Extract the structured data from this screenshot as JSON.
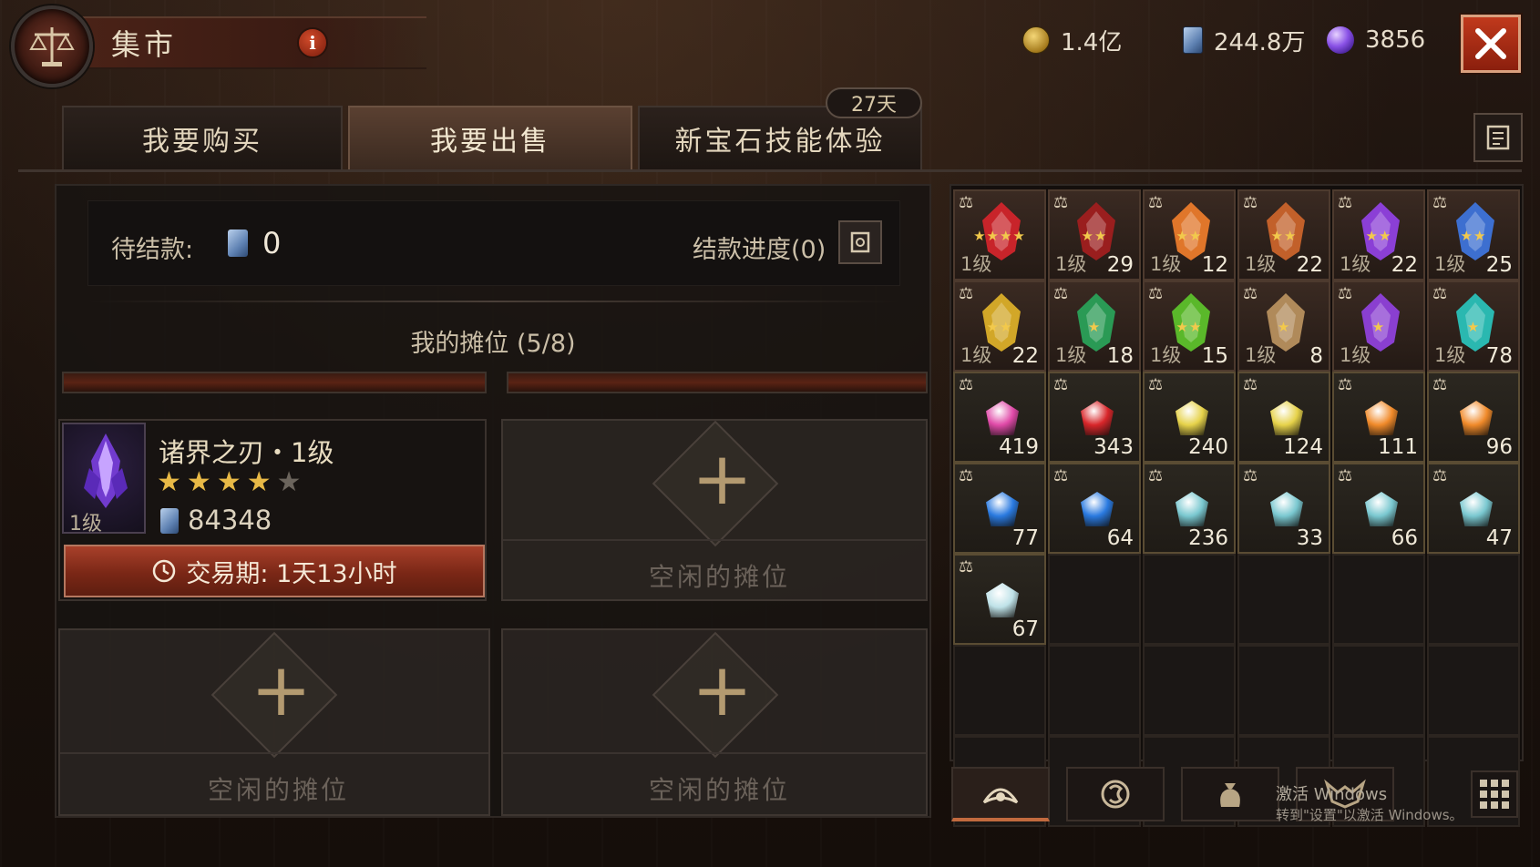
{
  "header": {
    "title": "集市",
    "info_icon_label": "i",
    "currencies": [
      {
        "icon": "gold-coin-icon",
        "value": "1.4亿"
      },
      {
        "icon": "platinum-icon",
        "value": "244.8万"
      },
      {
        "icon": "eternal-orb-icon",
        "value": "3856"
      }
    ],
    "close_icon": "close-icon"
  },
  "tabs": [
    {
      "label": "我要购买",
      "active": false
    },
    {
      "label": "我要出售",
      "active": true
    },
    {
      "label": "新宝石技能体验",
      "active": false
    }
  ],
  "days_badge": "27天",
  "sell": {
    "pending_label": "待结款:",
    "pending_value": "0",
    "settle_label": "结款进度(0)",
    "stalls_title": "我的摊位 (5/8)",
    "listed": {
      "name": "诸界之刃・1级",
      "level": "1级",
      "stars": 4,
      "max_stars": 5,
      "price": "84348",
      "trade_period_label": "交易期: 1天13小时"
    },
    "empty_stall_label": "空闲的摊位",
    "plus_symbol": "+"
  },
  "inventory": {
    "charms": [
      {
        "level": "1级",
        "qty": "",
        "stars": 4,
        "color": "#c8242a"
      },
      {
        "level": "1级",
        "qty": "29",
        "stars": 2,
        "color": "#9a1e1e"
      },
      {
        "level": "1级",
        "qty": "12",
        "stars": 2,
        "color": "#e0762a"
      },
      {
        "level": "1级",
        "qty": "22",
        "stars": 2,
        "color": "#c2602a"
      },
      {
        "level": "1级",
        "qty": "22",
        "stars": 2,
        "color": "#8b3fd6"
      },
      {
        "level": "1级",
        "qty": "25",
        "stars": 2,
        "color": "#3d6fd0"
      },
      {
        "level": "1级",
        "qty": "22",
        "stars": 2,
        "color": "#d2a728"
      },
      {
        "level": "1级",
        "qty": "18",
        "stars": 1,
        "color": "#2a9a55"
      },
      {
        "level": "1级",
        "qty": "15",
        "stars": 2,
        "color": "#5ab82a"
      },
      {
        "level": "1级",
        "qty": "8",
        "stars": 1,
        "color": "#b08a5a"
      },
      {
        "level": "1级",
        "qty": "",
        "stars": 1,
        "color": "#8a3fd0"
      },
      {
        "level": "1级",
        "qty": "78",
        "stars": 1,
        "color": "#2ab8b0"
      }
    ],
    "gems": [
      {
        "qty": "419",
        "color": "#e04aa8"
      },
      {
        "qty": "343",
        "color": "#d8262a"
      },
      {
        "qty": "240",
        "color": "#e6d24a"
      },
      {
        "qty": "124",
        "color": "#e6d24a"
      },
      {
        "qty": "111",
        "color": "#f08a2a"
      },
      {
        "qty": "96",
        "color": "#f08a2a"
      },
      {
        "qty": "77",
        "color": "#2a7ae0"
      },
      {
        "qty": "64",
        "color": "#2a7ae0"
      },
      {
        "qty": "236",
        "color": "#7ac8d0"
      },
      {
        "qty": "33",
        "color": "#7ac8d0"
      },
      {
        "qty": "66",
        "color": "#7ac8d0"
      },
      {
        "qty": "47",
        "color": "#7ac8d0"
      },
      {
        "qty": "67",
        "color": "#bfe2e8"
      }
    ],
    "lock_symbol": "⚖"
  },
  "bottom_tabs": [
    {
      "icon": "gem-category-icon",
      "active": true
    },
    {
      "icon": "rune-category-icon",
      "active": false
    },
    {
      "icon": "bag-category-icon",
      "active": false
    },
    {
      "icon": "demon-category-icon",
      "active": false
    }
  ],
  "watermark": {
    "line1": "激活 Windows",
    "line2": "转到\"设置\"以激活 Windows。"
  }
}
